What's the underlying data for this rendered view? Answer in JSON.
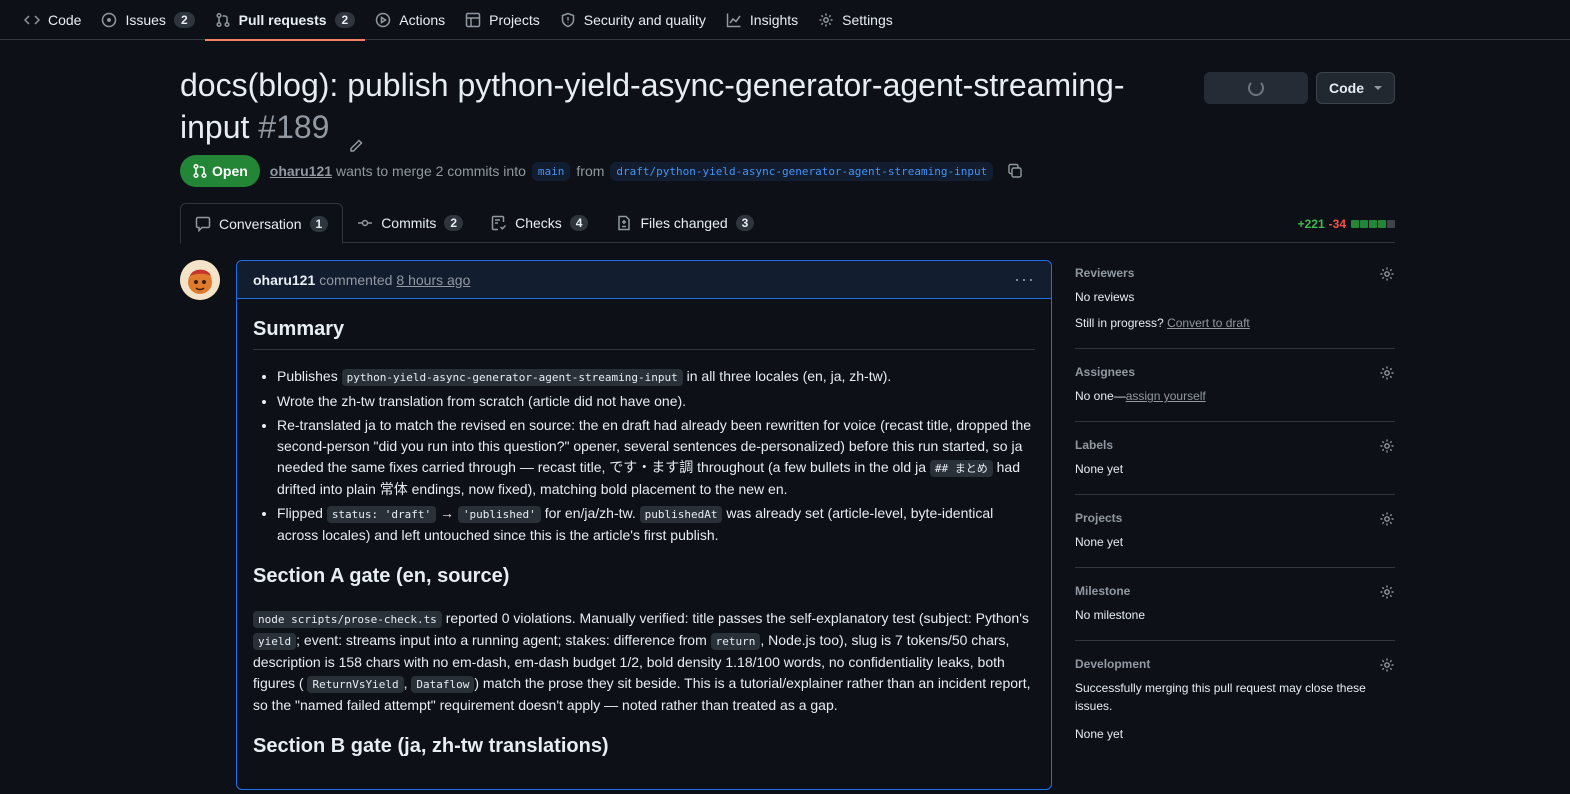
{
  "nav": {
    "items": [
      {
        "label": "Code",
        "icon": "code-icon"
      },
      {
        "label": "Issues",
        "icon": "issue-icon",
        "count": "2"
      },
      {
        "label": "Pull requests",
        "icon": "pull-request-icon",
        "count": "2"
      },
      {
        "label": "Actions",
        "icon": "play-icon"
      },
      {
        "label": "Projects",
        "icon": "table-icon"
      },
      {
        "label": "Security and quality",
        "icon": "shield-icon"
      },
      {
        "label": "Insights",
        "icon": "graph-icon"
      },
      {
        "label": "Settings",
        "icon": "gear-icon"
      }
    ]
  },
  "pr": {
    "title": "docs(blog): publish python-yield-async-generator-agent-streaming-input",
    "number": "#189",
    "state": "Open",
    "author": "oharu121",
    "merge_text": "wants to merge 2 commits into",
    "base": "main",
    "from_text": "from",
    "head": "draft/python-yield-async-generator-agent-streaming-input"
  },
  "code_button": "Code",
  "tabs": [
    {
      "label": "Conversation",
      "count": "1"
    },
    {
      "label": "Commits",
      "count": "2"
    },
    {
      "label": "Checks",
      "count": "4"
    },
    {
      "label": "Files changed",
      "count": "3"
    }
  ],
  "diffstat": {
    "additions": "+221",
    "deletions": "-34",
    "colors": [
      "#238636",
      "#238636",
      "#238636",
      "#238636",
      "#3d444d"
    ]
  },
  "comment": {
    "author": "oharu121",
    "action": "commented",
    "time": "8 hours ago",
    "summary_heading": "Summary",
    "b1_a": "Publishes",
    "b1_code": "python-yield-async-generator-agent-streaming-input",
    "b1_b": "in all three locales (en, ja, zh-tw).",
    "b2": "Wrote the zh-tw translation from scratch (article did not have one).",
    "b3_a": "Re-translated ja to match the revised en source: the en draft had already been rewritten for voice (recast title, dropped the second-person \"did you run into this question?\" opener, several sentences de-personalized) before this run started, so ja needed the same fixes carried through — recast title, です・ます調 throughout (a few bullets in the old ja",
    "b3_code": "## まとめ",
    "b3_b": "had drifted into plain 常体 endings, now fixed), matching bold placement to the new en.",
    "b4_a": "Flipped",
    "b4_code1": "status: 'draft'",
    "b4_arrow": "→",
    "b4_code2": "'published'",
    "b4_b": "for en/ja/zh-tw.",
    "b4_code3": "publishedAt",
    "b4_c": "was already set (article-level, byte-identical across locales) and left untouched since this is the article's first publish.",
    "secA_heading": "Section A gate (en, source)",
    "pA_code1": "node scripts/prose-check.ts",
    "pA_a": "reported 0 violations. Manually verified: title passes the self-explanatory test (subject: Python's",
    "pA_code2": "yield",
    "pA_b": "; event: streams input into a running agent; stakes: difference from",
    "pA_code3": "return",
    "pA_c": ", Node.js too), slug is 7 tokens/50 chars, description is 158 chars with no em-dash, em-dash budget 1/2, bold density 1.18/100 words, no confidentiality leaks, both figures (",
    "pA_code4": "ReturnVsYield",
    "pA_d": ",",
    "pA_code5": "Dataflow",
    "pA_e": ") match the prose they sit beside. This is a tutorial/explainer rather than an incident report, so the \"named failed attempt\" requirement doesn't apply — noted rather than treated as a gap.",
    "secB_heading": "Section B gate (ja, zh-tw translations)"
  },
  "sidebar": {
    "reviewers": {
      "title": "Reviewers",
      "value": "No reviews",
      "progress": "Still in progress?",
      "link": "Convert to draft"
    },
    "assignees": {
      "title": "Assignees",
      "value": "No one—",
      "link": "assign yourself"
    },
    "labels": {
      "title": "Labels",
      "value": "None yet"
    },
    "projects": {
      "title": "Projects",
      "value": "None yet"
    },
    "milestone": {
      "title": "Milestone",
      "value": "No milestone"
    },
    "development": {
      "title": "Development",
      "text": "Successfully merging this pull request may close these issues.",
      "value": "None yet"
    }
  }
}
